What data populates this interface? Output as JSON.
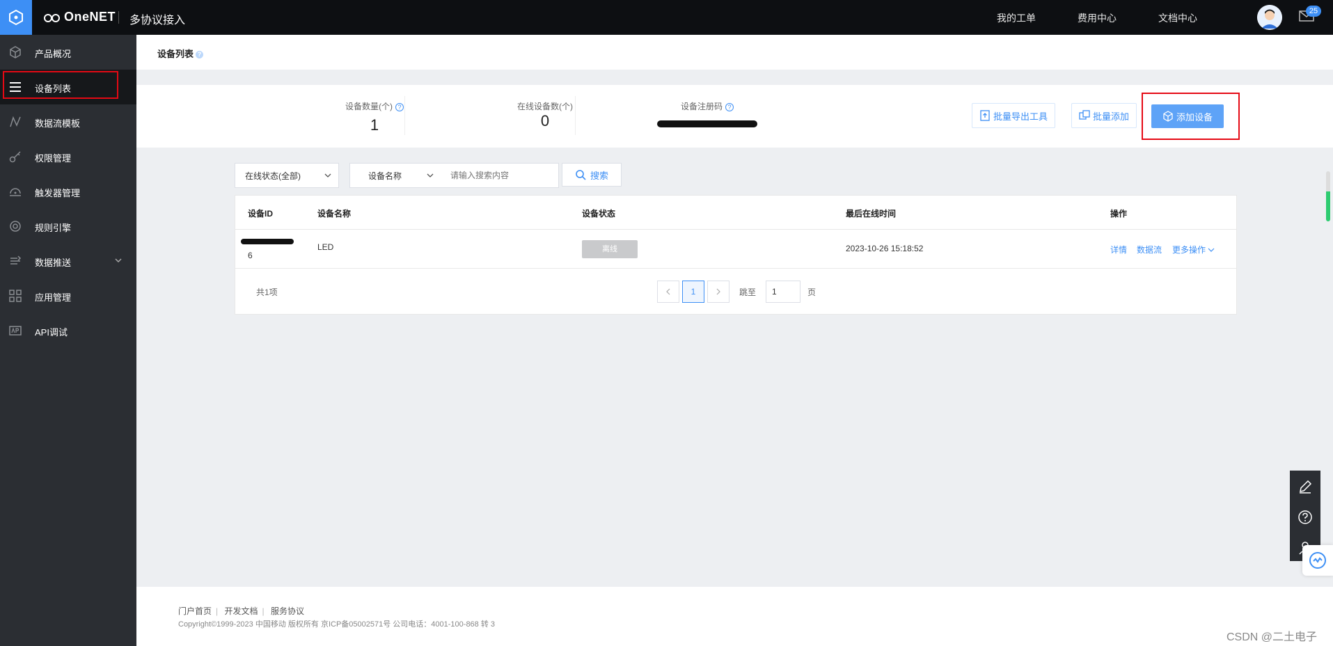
{
  "header": {
    "brand": "OneNET",
    "subtitle": "多协议接入",
    "links": [
      "我的工单",
      "费用中心",
      "文档中心"
    ],
    "mail_badge": "25"
  },
  "sidebar": {
    "items": [
      {
        "label": "产品概况",
        "icon": "cube-icon"
      },
      {
        "label": "设备列表",
        "icon": "list-icon",
        "active": true
      },
      {
        "label": "数据流模板",
        "icon": "stream-icon"
      },
      {
        "label": "权限管理",
        "icon": "key-icon"
      },
      {
        "label": "触发器管理",
        "icon": "trigger-icon"
      },
      {
        "label": "规则引擎",
        "icon": "rule-icon"
      },
      {
        "label": "数据推送",
        "icon": "push-icon"
      },
      {
        "label": "应用管理",
        "icon": "grid-icon"
      },
      {
        "label": "API调试",
        "icon": "api-icon"
      }
    ]
  },
  "page": {
    "title": "设备列表",
    "title_help": "?"
  },
  "stats": {
    "device_count_label": "设备数量(个)",
    "device_count": "1",
    "online_count_label": "在线设备数(个)",
    "online_count": "0",
    "reg_code_label": "设备注册码"
  },
  "actions": {
    "export": "批量导出工具",
    "batch_add": "批量添加",
    "add_device": "添加设备"
  },
  "filters": {
    "status": "在线状态(全部)",
    "field": "设备名称",
    "search_placeholder": "请输入搜索内容",
    "search_button": "搜索"
  },
  "table": {
    "headers": [
      "设备ID",
      "设备名称",
      "设备状态",
      "最后在线时间",
      "操作"
    ],
    "rows": [
      {
        "id_suffix": "6",
        "name": "LED",
        "status": "离线",
        "last_online": "2023-10-26 15:18:52"
      }
    ],
    "ops": [
      "详情",
      "数据流",
      "更多操作"
    ]
  },
  "pagination": {
    "total": "共1项",
    "current": "1",
    "jump_label": "跳至",
    "jump_value": "1",
    "page_unit": "页"
  },
  "footer": {
    "links": [
      "门户首页",
      "开发文档",
      "服务协议"
    ],
    "copyright": "Copyright©1999-2023 中国移动 版权所有 京ICP备05002571号 公司电话：4001-100-868 转 3"
  },
  "watermark": "CSDN @二土电子",
  "colors": {
    "accent": "#3d8ff5",
    "sidebar": "#2b2e33",
    "topbar": "#0d0f12",
    "highlight": "#e50914"
  }
}
